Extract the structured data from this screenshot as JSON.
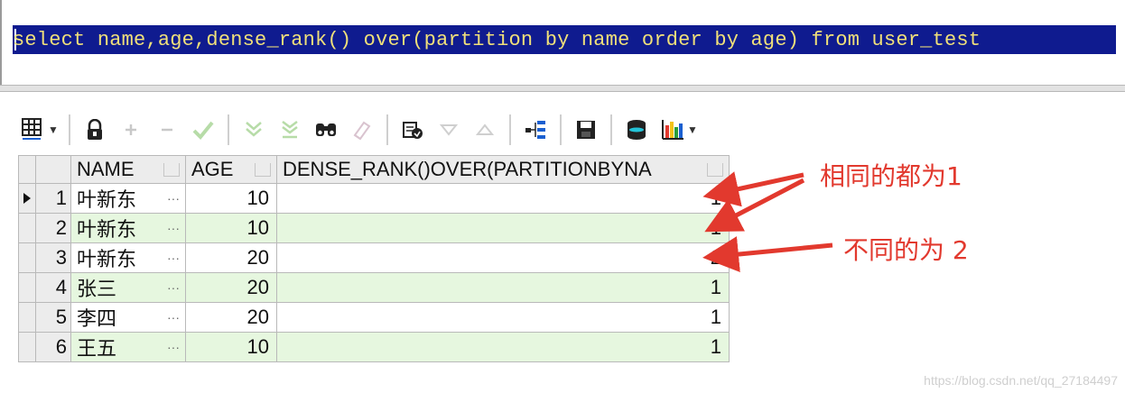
{
  "editor": {
    "sql": "select name,age,dense_rank() over(partition by name order by age) from user_test"
  },
  "toolbar": {
    "items": [
      "grid-icon",
      "lock-icon",
      "plus-icon",
      "minus-icon",
      "check-icon",
      "filter-down-icon",
      "filter-down-all-icon",
      "binoculars-icon",
      "eraser-icon",
      "export-icon",
      "triangle-down-icon",
      "triangle-up-icon",
      "query-tree-icon",
      "save-icon",
      "database-icon",
      "chart-icon"
    ]
  },
  "grid": {
    "columns": [
      "NAME",
      "AGE",
      "DENSE_RANK()OVER(PARTITIONBYNA"
    ],
    "rows": [
      {
        "num": "1",
        "name": "叶新东",
        "age": "10",
        "rank": "1"
      },
      {
        "num": "2",
        "name": "叶新东",
        "age": "10",
        "rank": "1"
      },
      {
        "num": "3",
        "name": "叶新东",
        "age": "20",
        "rank": "2"
      },
      {
        "num": "4",
        "name": "张三",
        "age": "20",
        "rank": "1"
      },
      {
        "num": "5",
        "name": "李四",
        "age": "20",
        "rank": "1"
      },
      {
        "num": "6",
        "name": "王五",
        "age": "10",
        "rank": "1"
      }
    ],
    "ellipsis": "···"
  },
  "annotations": {
    "same": "相同的都为1",
    "different": "不同的为 2",
    "color": "#e2392e"
  },
  "watermark": "https://blog.csdn.net/qq_27184497"
}
